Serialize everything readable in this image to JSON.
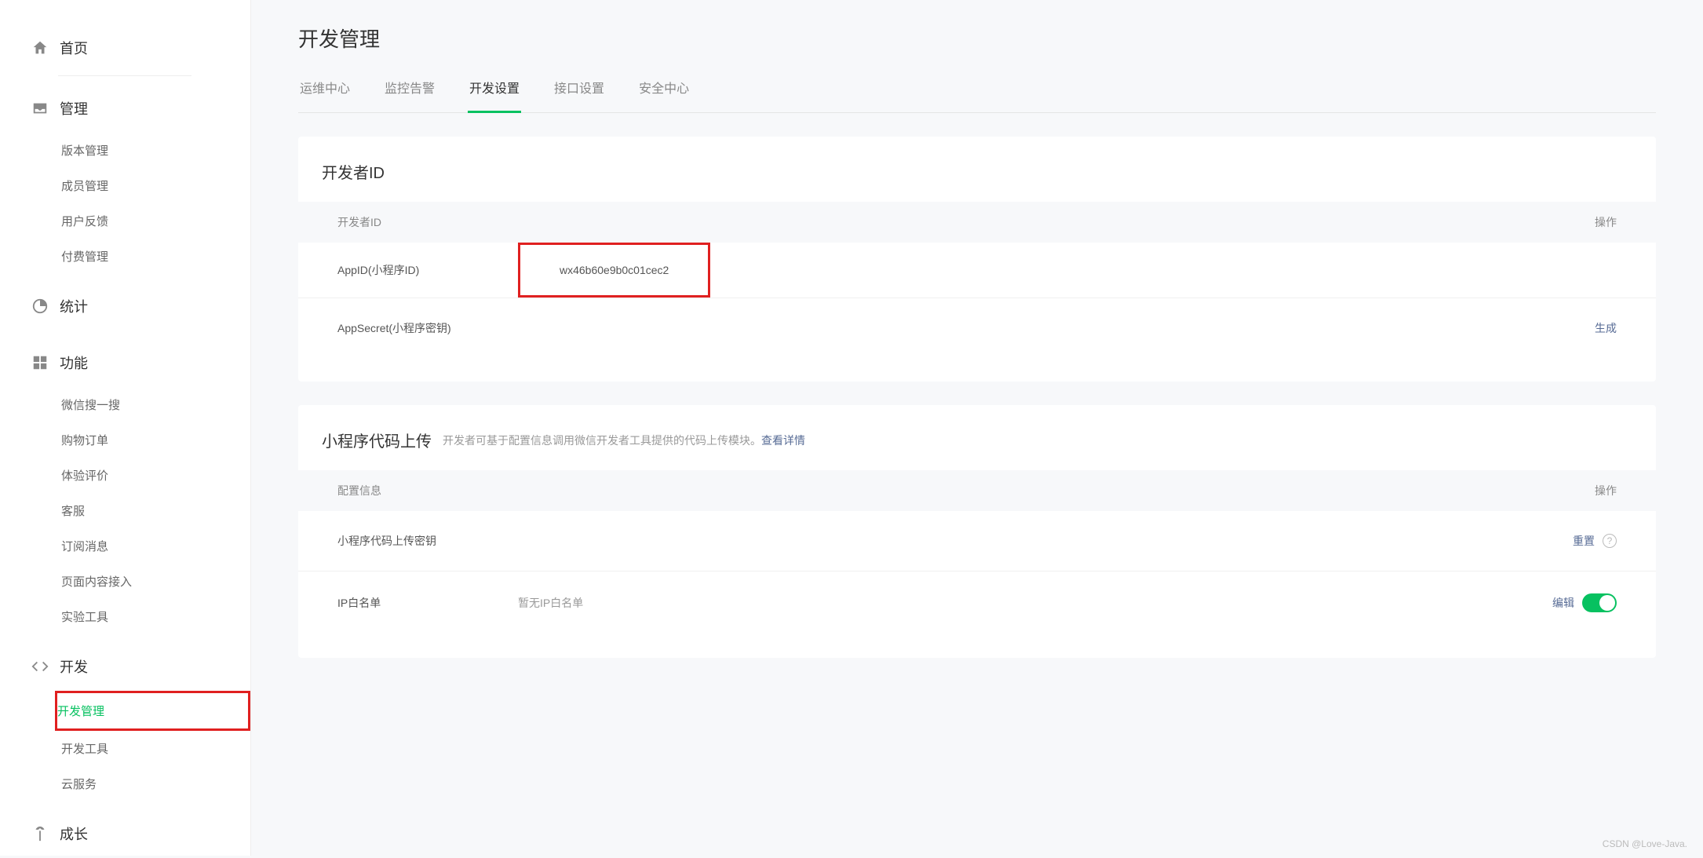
{
  "sidebar": {
    "home": "首页",
    "manage": {
      "label": "管理",
      "items": [
        "版本管理",
        "成员管理",
        "用户反馈",
        "付费管理"
      ]
    },
    "stats": {
      "label": "统计"
    },
    "features": {
      "label": "功能",
      "items": [
        "微信搜一搜",
        "购物订单",
        "体验评价",
        "客服",
        "订阅消息",
        "页面内容接入",
        "实验工具"
      ]
    },
    "dev": {
      "label": "开发",
      "items": [
        "开发管理",
        "开发工具",
        "云服务"
      ],
      "activeIndex": 0
    },
    "growth": {
      "label": "成长"
    }
  },
  "page": {
    "title": "开发管理",
    "tabs": [
      "运维中心",
      "监控告警",
      "开发设置",
      "接口设置",
      "安全中心"
    ],
    "activeTab": 2
  },
  "devId": {
    "title": "开发者ID",
    "header_label": "开发者ID",
    "header_action": "操作",
    "appid_label": "AppID(小程序ID)",
    "appid_value": "wx46b60e9b0c01cec2",
    "appsecret_label": "AppSecret(小程序密钥)",
    "appsecret_action": "生成"
  },
  "upload": {
    "title": "小程序代码上传",
    "subtitle": "开发者可基于配置信息调用微信开发者工具提供的代码上传模块。",
    "detail_link": "查看详情",
    "header_label": "配置信息",
    "header_action": "操作",
    "key_label": "小程序代码上传密钥",
    "key_action": "重置",
    "ip_label": "IP白名单",
    "ip_value": "暂无IP白名单",
    "ip_action": "编辑"
  },
  "watermark": "CSDN @Love-Java."
}
